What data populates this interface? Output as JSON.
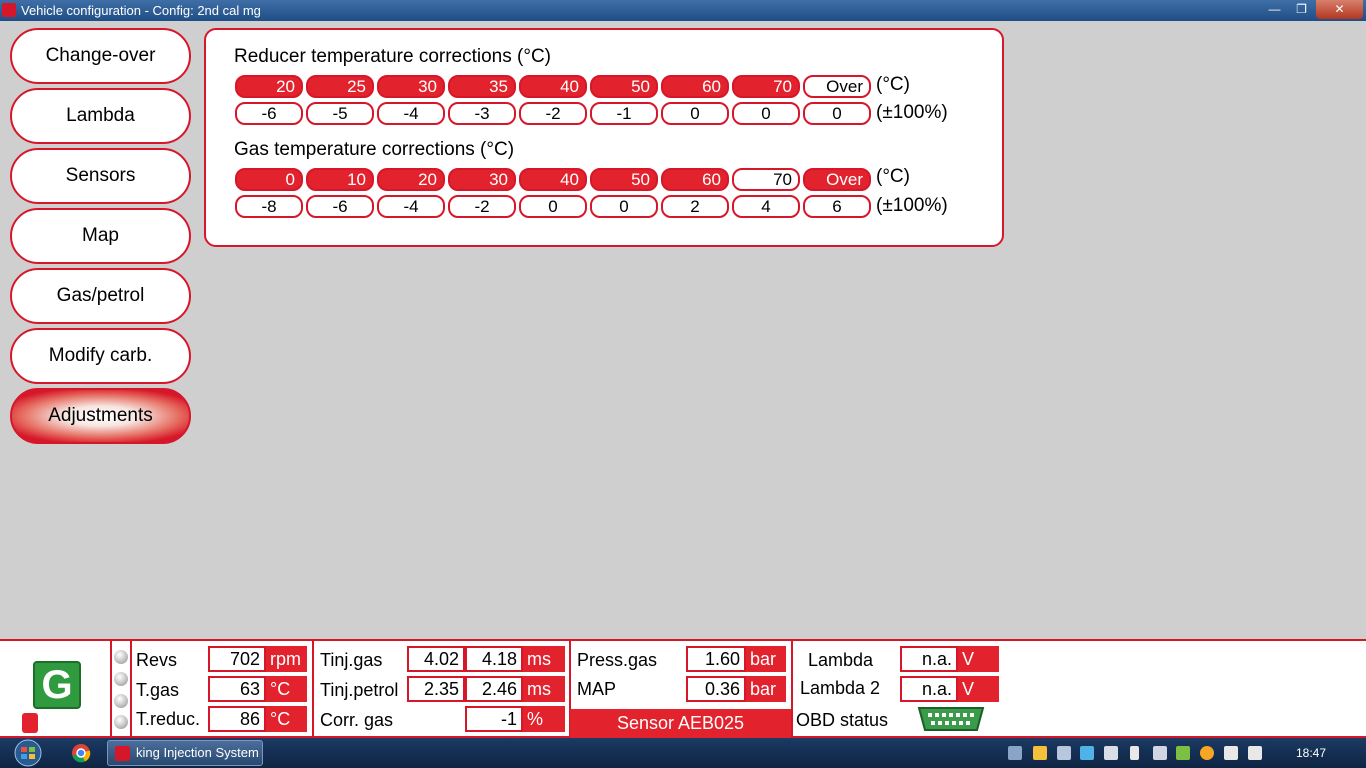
{
  "window": {
    "title": "Vehicle configuration - Config: 2nd cal mg",
    "close_glyph": "✕",
    "max_glyph": "❐",
    "min_glyph": "—"
  },
  "sidebar": {
    "items": [
      {
        "label": "Change-over"
      },
      {
        "label": "Lambda"
      },
      {
        "label": "Sensors"
      },
      {
        "label": "Map"
      },
      {
        "label": "Gas/petrol"
      },
      {
        "label": "Modify carb."
      },
      {
        "label": "Adjustments",
        "active": true
      }
    ]
  },
  "reducer": {
    "title": "Reducer temperature corrections (°C)",
    "temps": [
      "20",
      "25",
      "30",
      "35",
      "40",
      "50",
      "60",
      "70",
      "Over"
    ],
    "corrections": [
      "-6",
      "-5",
      "-4",
      "-3",
      "-2",
      "-1",
      "0",
      "0",
      "0"
    ],
    "highlighted": [
      true,
      true,
      true,
      true,
      true,
      true,
      true,
      true,
      false
    ],
    "unit_temp": "(°C)",
    "unit_corr": "(±100%)"
  },
  "gas": {
    "title": "Gas temperature corrections (°C)",
    "temps": [
      "0",
      "10",
      "20",
      "30",
      "40",
      "50",
      "60",
      "70",
      "Over"
    ],
    "corrections": [
      "-8",
      "-6",
      "-4",
      "-2",
      "0",
      "0",
      "2",
      "4",
      "6"
    ],
    "highlighted": [
      true,
      true,
      true,
      true,
      true,
      true,
      true,
      false,
      true
    ],
    "unit_temp": "(°C)",
    "unit_corr": "(±100%)"
  },
  "status": {
    "fuel_badge": "G",
    "revs": {
      "label": "Revs",
      "value": "702",
      "unit": "rpm"
    },
    "tgas": {
      "label": "T.gas",
      "value": "63",
      "unit": "°C"
    },
    "treduc": {
      "label": "T.reduc.",
      "value": "86",
      "unit": "°C"
    },
    "tinj_gas": {
      "label": "Tinj.gas",
      "value1": "4.02",
      "value2": "4.18",
      "unit": "ms"
    },
    "tinj_petrol": {
      "label": "Tinj.petrol",
      "value1": "2.35",
      "value2": "2.46",
      "unit": "ms"
    },
    "corr_gas": {
      "label": "Corr. gas",
      "value": "-1",
      "unit": "%"
    },
    "press_gas": {
      "label": "Press.gas",
      "value": "1.60",
      "unit": "bar"
    },
    "map": {
      "label": "MAP",
      "value": "0.36",
      "unit": "bar"
    },
    "sensor": "Sensor AEB025",
    "lambda": {
      "label": "Lambda",
      "value": "n.a.",
      "unit": "V"
    },
    "lambda2": {
      "label": "Lambda 2",
      "value": "n.a.",
      "unit": "V"
    },
    "obd": {
      "label": "OBD status",
      "icon": "obd-connector-icon"
    }
  },
  "taskbar": {
    "app_label": "king Injection System",
    "clock": "18:47"
  },
  "colors": {
    "accent": "#d6172a",
    "badge_green": "#2f9a3e"
  }
}
